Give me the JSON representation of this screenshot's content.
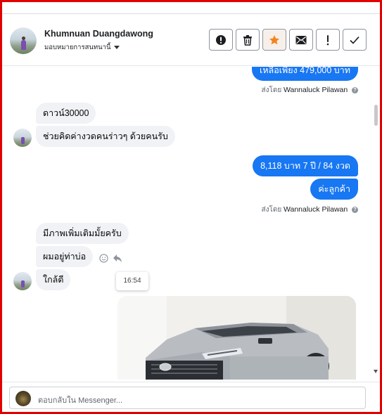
{
  "header": {
    "name": "Khumnuan Duangdawong",
    "assign_label": "มอบหมายการสนทนานี้"
  },
  "toolbar": {
    "buttons": [
      {
        "id": "spam",
        "icon": "exclamation-circle-icon"
      },
      {
        "id": "delete",
        "icon": "trash-icon"
      },
      {
        "id": "star",
        "icon": "star-icon",
        "color": "#f5821f"
      },
      {
        "id": "mark-unread",
        "icon": "envelope-icon"
      },
      {
        "id": "follow-up",
        "icon": "exclamation-icon"
      },
      {
        "id": "done",
        "icon": "checkmark-icon"
      }
    ]
  },
  "messages": {
    "out_1": "เหลือเพียง 479,000 บาท",
    "sent_by_1": {
      "prefix": "ส่งโดย",
      "name": "Wannaluck Pilawan"
    },
    "in_1": "ดาวน์30000",
    "in_2": "ช่วยคิดค่างวดคนร่าวๆ ด้วยคนรับ",
    "out_2": "8,118 บาท  7 ปี / 84 งวด",
    "out_3": "ค่ะลูกค้า",
    "sent_by_2": {
      "prefix": "ส่งโดย",
      "name": "Wannaluck Pilawan"
    },
    "in_3": "มีภาพเพิ่มเติมมั้ยครับ",
    "in_4": "ผมอยู่ท่าบ่อ",
    "in_5": "ใกล้ดี",
    "tooltip_time": "16:54"
  },
  "composer": {
    "placeholder": "ตอบกลับใน Messenger..."
  },
  "colors": {
    "accent": "#1877f2",
    "incoming_bg": "#f0f2f5",
    "frame": "#e00000"
  }
}
